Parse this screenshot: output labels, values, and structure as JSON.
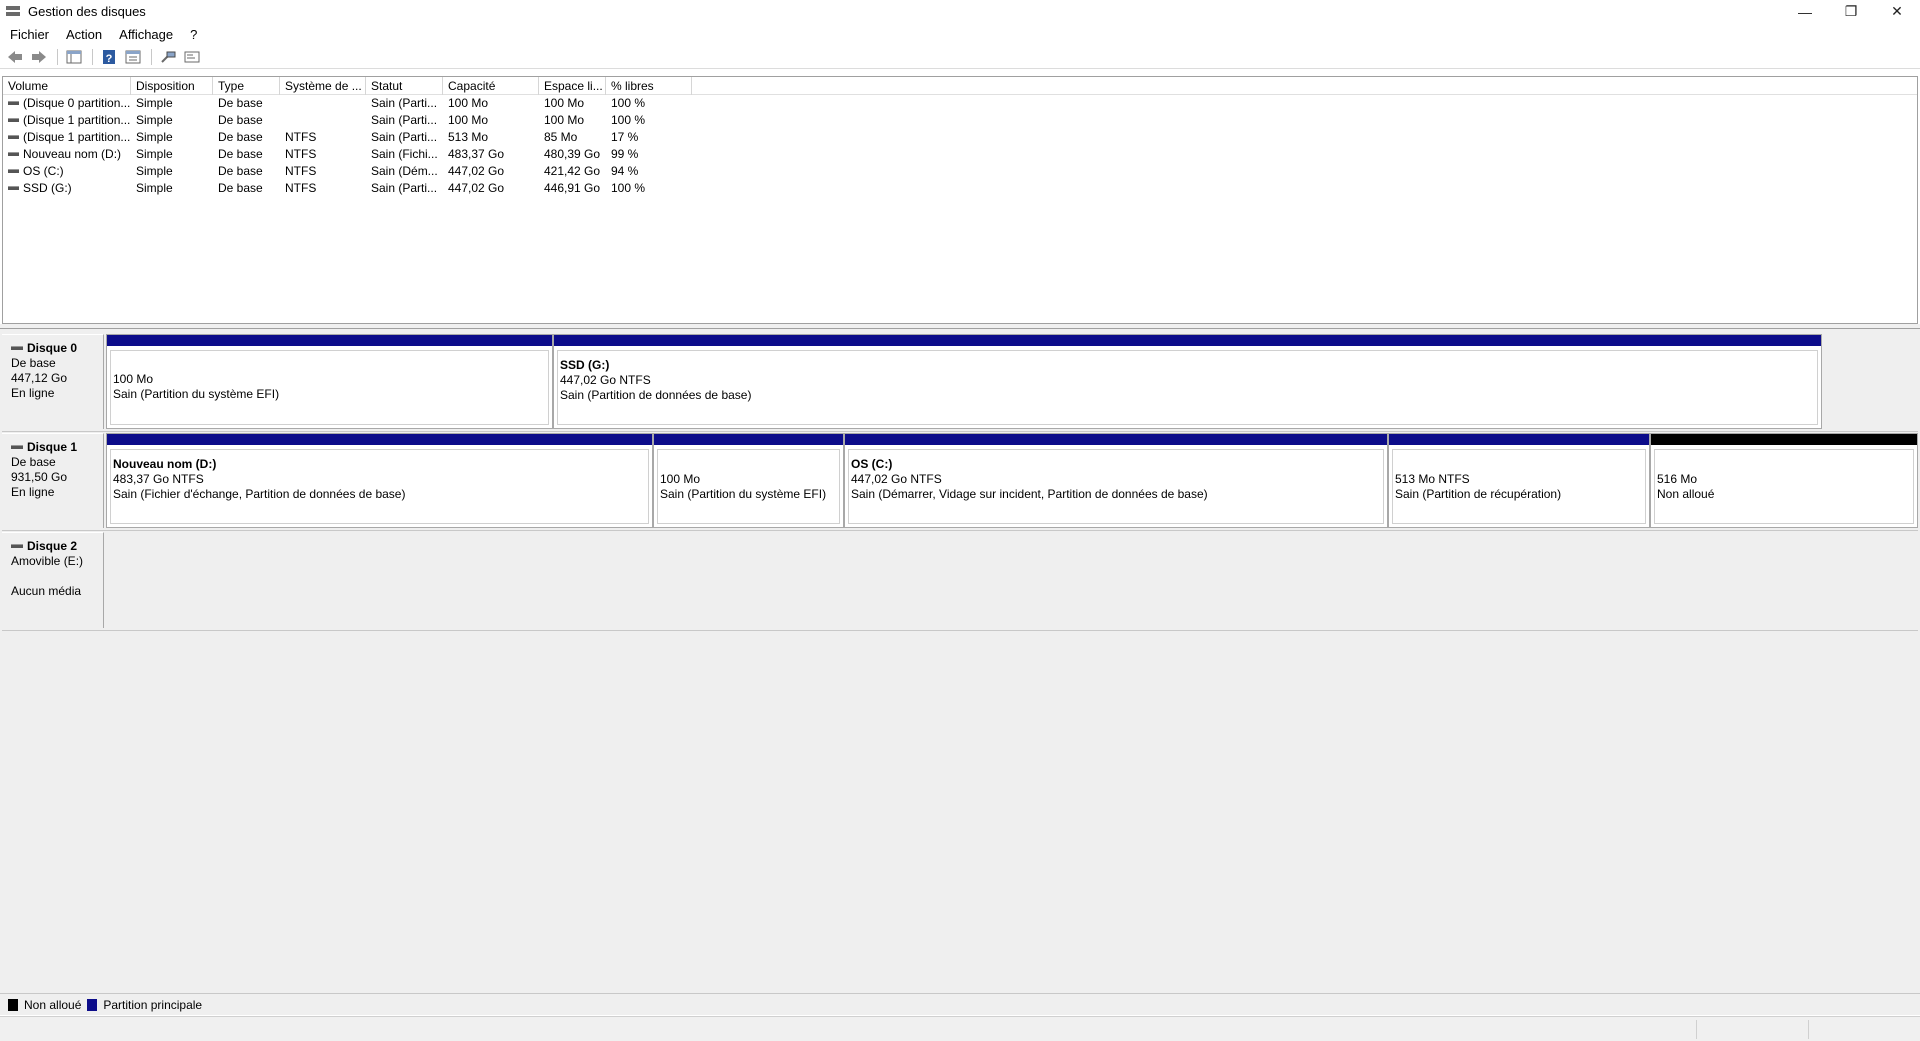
{
  "window": {
    "title": "Gestion des disques",
    "minimize_glyph": "—",
    "restore_glyph": "❐",
    "close_glyph": "✕"
  },
  "menu": [
    "Fichier",
    "Action",
    "Affichage",
    "?"
  ],
  "toolbar_icons": [
    "back-arrow-icon",
    "forward-arrow-icon",
    "console-tree-icon",
    "help-icon",
    "properties-icon",
    "connect-icon",
    "settings-icon"
  ],
  "volume_list": {
    "columns": [
      "Volume",
      "Disposition",
      "Type",
      "Système de ...",
      "Statut",
      "Capacité",
      "Espace li...",
      "% libres"
    ],
    "rows": [
      [
        "(Disque 0 partition...",
        "Simple",
        "De base",
        "",
        "Sain (Parti...",
        "100 Mo",
        "100 Mo",
        "100 %"
      ],
      [
        "(Disque 1 partition...",
        "Simple",
        "De base",
        "",
        "Sain (Parti...",
        "100 Mo",
        "100 Mo",
        "100 %"
      ],
      [
        "(Disque 1 partition...",
        "Simple",
        "De base",
        "NTFS",
        "Sain (Parti...",
        "513 Mo",
        "85 Mo",
        "17 %"
      ],
      [
        "Nouveau nom (D:)",
        "Simple",
        "De base",
        "NTFS",
        "Sain (Fichi...",
        "483,37 Go",
        "480,39 Go",
        "99 %"
      ],
      [
        "OS (C:)",
        "Simple",
        "De base",
        "NTFS",
        "Sain (Dém...",
        "447,02 Go",
        "421,42 Go",
        "94 %"
      ],
      [
        "SSD (G:)",
        "Simple",
        "De base",
        "NTFS",
        "Sain (Parti...",
        "447,02 Go",
        "446,91 Go",
        "100 %"
      ]
    ]
  },
  "disks": [
    {
      "name": "Disque 0",
      "type": "De base",
      "size": "447,12 Go",
      "status": "En ligne",
      "partitions": [
        {
          "name": "",
          "size": "100 Mo",
          "status": "Sain (Partition du système EFI)",
          "kind": "primary"
        },
        {
          "name": "SSD  (G:)",
          "size": "447,02 Go NTFS",
          "status": "Sain (Partition de données de base)",
          "kind": "primary"
        }
      ]
    },
    {
      "name": "Disque 1",
      "type": "De base",
      "size": "931,50 Go",
      "status": "En ligne",
      "partitions": [
        {
          "name": "Nouveau nom  (D:)",
          "size": "483,37 Go NTFS",
          "status": "Sain (Fichier d'échange, Partition de données de base)",
          "kind": "primary"
        },
        {
          "name": "",
          "size": "100 Mo",
          "status": "Sain (Partition du système EFI)",
          "kind": "primary"
        },
        {
          "name": "OS  (C:)",
          "size": "447,02 Go NTFS",
          "status": "Sain (Démarrer, Vidage sur incident, Partition de données de base)",
          "kind": "primary"
        },
        {
          "name": "",
          "size": "513 Mo NTFS",
          "status": "Sain (Partition de récupération)",
          "kind": "primary"
        },
        {
          "name": "",
          "size": "516 Mo",
          "status": "Non alloué",
          "kind": "unallocated"
        }
      ]
    },
    {
      "name": "Disque 2",
      "type": "Amovible (E:)",
      "size": "",
      "status": "Aucun média",
      "partitions": []
    }
  ],
  "legend": [
    {
      "label": "Non alloué",
      "color": "#000000"
    },
    {
      "label": "Partition principale",
      "color": "#0c0c8a"
    }
  ]
}
